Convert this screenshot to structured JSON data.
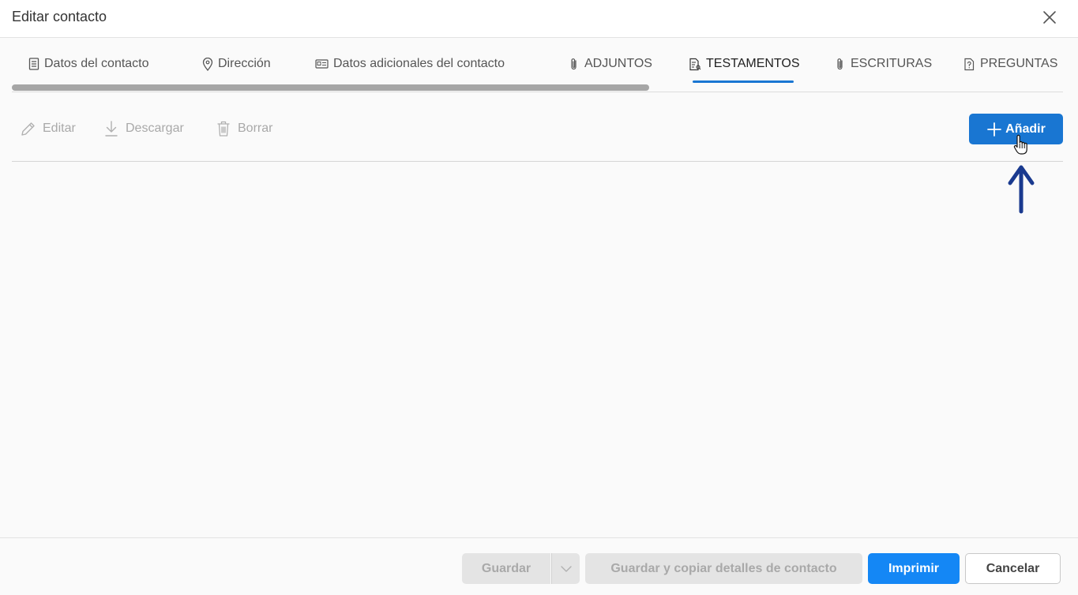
{
  "dialog": {
    "title": "Editar contacto",
    "close_icon": "close-icon"
  },
  "tabs": [
    {
      "label": "Datos del contacto",
      "icon": "contact-card-icon"
    },
    {
      "label": "Dirección",
      "icon": "location-pin-icon"
    },
    {
      "label": "Datos adicionales del contacto",
      "icon": "id-card-icon"
    },
    {
      "label": "ADJUNTOS",
      "icon": "paperclip-icon"
    },
    {
      "label": "TESTAMENTOS",
      "icon": "document-icon",
      "active": true
    },
    {
      "label": "ESCRITURAS",
      "icon": "paperclip-icon"
    },
    {
      "label": "PREGUNTAS",
      "icon": "question-document-icon"
    }
  ],
  "toolbar": {
    "edit_label": "Editar",
    "download_label": "Descargar",
    "delete_label": "Borrar",
    "add_label": "Añadir"
  },
  "footer": {
    "save_label": "Guardar",
    "save_copy_label": "Guardar y copiar detalles de contacto",
    "print_label": "Imprimir",
    "cancel_label": "Cancelar"
  },
  "colors": {
    "accent": "#1976d2",
    "print_button": "#1487f5",
    "annotation_arrow": "#1a3a8f",
    "disabled_text": "#a9a9a9"
  }
}
